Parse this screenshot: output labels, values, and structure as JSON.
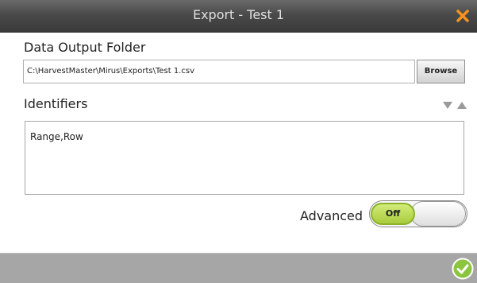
{
  "window": {
    "title": "Export - Test 1"
  },
  "output": {
    "label": "Data Output Folder",
    "path": "C:\\HarvestMaster\\Mirus\\Exports\\Test 1.csv",
    "browse_label": "Browse"
  },
  "identifiers": {
    "label": "Identifiers",
    "value": "Range,Row"
  },
  "advanced": {
    "label": "Advanced",
    "toggle_text": "Off"
  },
  "colors": {
    "accent": "#f7931e",
    "toggle_green": "#a9cc3c",
    "ok_green": "#8bc53f"
  },
  "icons": {
    "close": "close-icon",
    "sort_down": "triangle-down-icon",
    "sort_up": "triangle-up-icon",
    "ok": "checkmark-circle-icon"
  }
}
